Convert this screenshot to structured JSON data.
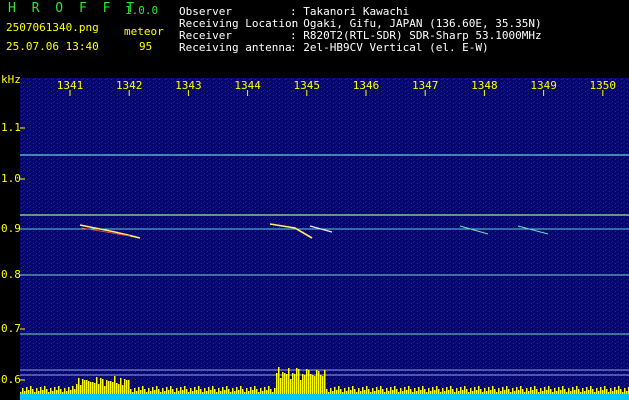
{
  "app": {
    "name": "H R O F F T",
    "version": "1.0.0"
  },
  "capture": {
    "filename": "2507061340.png",
    "mode": "meteor",
    "datetime": "25.07.06 13:40",
    "count": "95"
  },
  "station": {
    "observer_label": "Observer",
    "observer_value": ": Takanori Kawachi",
    "location_label": "Receiving Location",
    "location_value": ": Ogaki, Gifu, JAPAN (136.60E, 35.35N)",
    "receiver_label": "Receiver",
    "receiver_value": ": R820T2(RTL-SDR) SDR-Sharp 53.1000MHz",
    "antenna_label": "Receiving antenna",
    "antenna_value": ": 2el-HB9CV Vertical (el. E-W)"
  },
  "axis": {
    "y_unit": "kHz",
    "x_ticks": [
      "1341",
      "1342",
      "1343",
      "1344",
      "1345",
      "1346",
      "1347",
      "1348",
      "1349",
      "1350"
    ],
    "y_ticks": [
      "1.1",
      "1.0",
      "0.9",
      "0.8",
      "0.7",
      "0.6"
    ]
  },
  "colors": {
    "background": "#06066e",
    "tick_label": "#ffff00",
    "trace": "#ffff00",
    "header_text": "#ffffff",
    "accent": "#2ee62e"
  }
}
